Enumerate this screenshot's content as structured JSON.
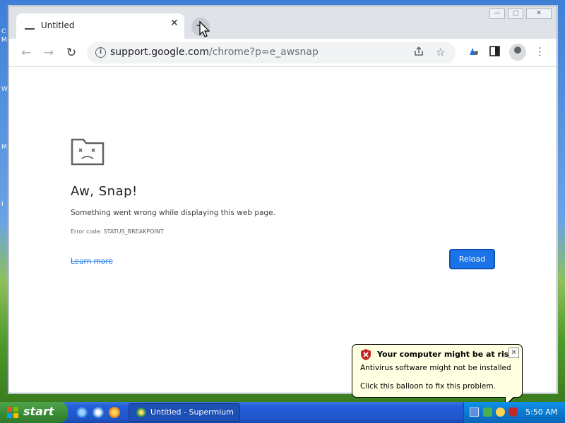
{
  "desktop": {
    "edge_labels": [
      "C",
      "M",
      "W",
      "M",
      "I"
    ]
  },
  "window": {
    "tab": {
      "title": "Untitled",
      "close_glyph": "✕"
    },
    "new_tab_glyph": "+",
    "controls": {
      "minimize": "—",
      "maximize": "▢",
      "close": "✕"
    }
  },
  "toolbar": {
    "back_glyph": "←",
    "forward_glyph": "→",
    "reload_glyph": "↻",
    "url_host": "support.google.com",
    "url_path": "/chrome?p=e_awsnap",
    "icons": [
      "info-icon",
      "share-icon",
      "star-icon",
      "extensions-icon",
      "side-panel-icon",
      "profile-icon",
      "menu-icon"
    ]
  },
  "content": {
    "title": "Aw, Snap!",
    "message": "Something went wrong while displaying this web page.",
    "error_code": "Error code: STATUS_BREAKPOINT",
    "learn_more": "Learn more",
    "reload_label": "Reload"
  },
  "balloon": {
    "title": "Your computer might be at risk",
    "line1": "Antivirus software might not be installed",
    "line2": "Click this balloon to fix this problem.",
    "close_glyph": "✕"
  },
  "taskbar": {
    "start_label": "start",
    "task_label": "Untitled - Supermium",
    "clock": "5:50 AM"
  },
  "colors": {
    "accent": "#1a73e8",
    "balloon_bg": "#ffffe1",
    "taskbar": "#245edb",
    "start_green": "#3b8e37"
  }
}
